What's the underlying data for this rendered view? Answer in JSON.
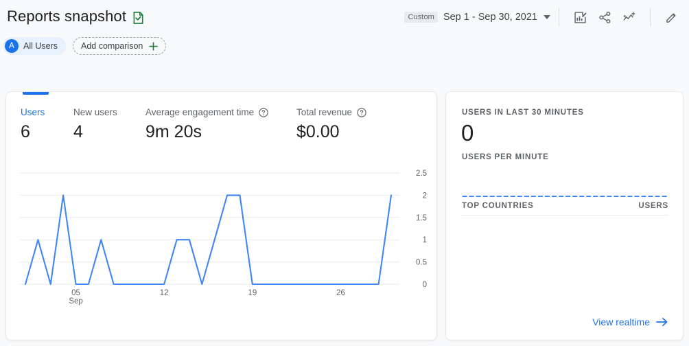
{
  "header": {
    "title": "Reports snapshot",
    "title_icon": "document-check-icon",
    "segment_chip": {
      "avatar_letter": "A",
      "label": "All Users"
    },
    "add_comparison": {
      "label": "Add comparison",
      "icon": "plus-icon"
    },
    "date_control": {
      "badge": "Custom",
      "range": "Sep 1 - Sep 30, 2021",
      "caret_icon": "chevron-down-icon"
    },
    "actions": [
      {
        "name": "insights-icon",
        "tooltip": "Insights"
      },
      {
        "name": "share-icon",
        "tooltip": "Share"
      },
      {
        "name": "add-trend-icon",
        "tooltip": "Add comparison"
      },
      {
        "name": "edit-pencil-icon",
        "tooltip": "Edit"
      }
    ]
  },
  "metrics": [
    {
      "label": "Users",
      "value": "6",
      "active": true,
      "has_help": false
    },
    {
      "label": "New users",
      "value": "4",
      "active": false,
      "has_help": false
    },
    {
      "label": "Average engagement time",
      "value": "9m 20s",
      "active": false,
      "has_help": true
    },
    {
      "label": "Total revenue",
      "value": "$0.00",
      "active": false,
      "has_help": true
    }
  ],
  "realtime": {
    "users_label": "USERS IN LAST 30 MINUTES",
    "users_value": "0",
    "per_minute_label": "USERS PER MINUTE",
    "per_minute_values": [
      0,
      0,
      0,
      0,
      0,
      0,
      0,
      0,
      0,
      0,
      0,
      0,
      0,
      0,
      0,
      0,
      0,
      0,
      0,
      0,
      0,
      0,
      0,
      0,
      0,
      0,
      0,
      0,
      0,
      0
    ],
    "top_countries_label": "TOP COUNTRIES",
    "users_column_label": "USERS",
    "countries": [],
    "view_realtime_label": "View realtime",
    "view_realtime_icon": "arrow-right-icon"
  },
  "colors": {
    "accent_blue": "#1a73e8",
    "line_blue": "#4285f4",
    "page_bg": "#f8f9fa",
    "card_bg": "#ffffff",
    "text_primary": "#202124",
    "text_secondary": "#5f6368",
    "grid": "#e8eaed",
    "green_icon": "#188038"
  },
  "chart_data": {
    "type": "line",
    "title": "",
    "xlabel": "",
    "ylabel": "",
    "series": [
      {
        "name": "Users",
        "values": [
          0,
          1,
          0,
          2,
          0,
          0,
          1,
          0,
          0,
          0,
          0,
          0,
          1,
          1,
          0,
          1,
          2,
          2,
          0,
          0,
          0,
          0,
          0,
          0,
          0,
          0,
          0,
          0,
          0,
          2
        ]
      }
    ],
    "x": [
      "1",
      "2",
      "3",
      "4",
      "5",
      "6",
      "7",
      "8",
      "9",
      "10",
      "11",
      "12",
      "13",
      "14",
      "15",
      "16",
      "17",
      "18",
      "19",
      "20",
      "21",
      "22",
      "23",
      "24",
      "25",
      "26",
      "27",
      "28",
      "29",
      "30"
    ],
    "xtick_labels": [
      "05",
      "12",
      "19",
      "26"
    ],
    "xtick_positions": [
      5,
      12,
      19,
      26
    ],
    "xaxis_unit": "Sep",
    "ytick_labels": [
      "2.5",
      "2",
      "1.5",
      "1",
      "0.5",
      "0"
    ],
    "ytick_values": [
      2.5,
      2,
      1.5,
      1,
      0.5,
      0
    ],
    "ylim": [
      0,
      2.5
    ],
    "grid": true,
    "legend": "none",
    "line_color": "#4285f4"
  }
}
